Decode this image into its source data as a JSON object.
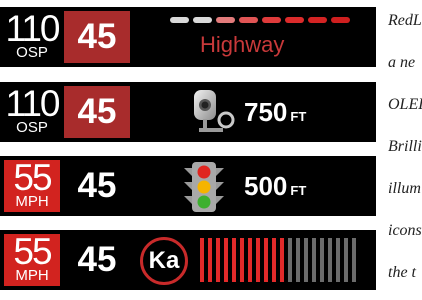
{
  "panels": [
    {
      "speed": "110",
      "unit": "OSP",
      "limit": "45",
      "label": "Highway"
    },
    {
      "speed": "110",
      "unit": "OSP",
      "limit": "45",
      "distance": "750",
      "distance_unit": "FT",
      "icon": "speed-camera-icon"
    },
    {
      "speed": "55",
      "unit": "MPH",
      "limit": "45",
      "distance": "500",
      "distance_unit": "FT",
      "icon": "traffic-light-icon"
    },
    {
      "speed": "55",
      "unit": "MPH",
      "limit": "45",
      "band": "Ka",
      "signal_strength": 0.55
    }
  ],
  "highway_dashes": [
    "#d9d9d9",
    "#d9d9d9",
    "#e27b7b",
    "#e15555",
    "#df3b3b",
    "#dc2b2b",
    "#d42323",
    "#cf1f1f"
  ],
  "colors": {
    "panel_bg": "#000000",
    "alert_red": "#d2231f",
    "limit_red": "#a82c2c",
    "bar_active": "#e12a2a",
    "bar_inactive": "#6b6b6b"
  },
  "side_text": [
    "RedL",
    "a ne",
    "OLEL",
    "Brilli",
    "illum",
    "icons",
    "the t"
  ]
}
